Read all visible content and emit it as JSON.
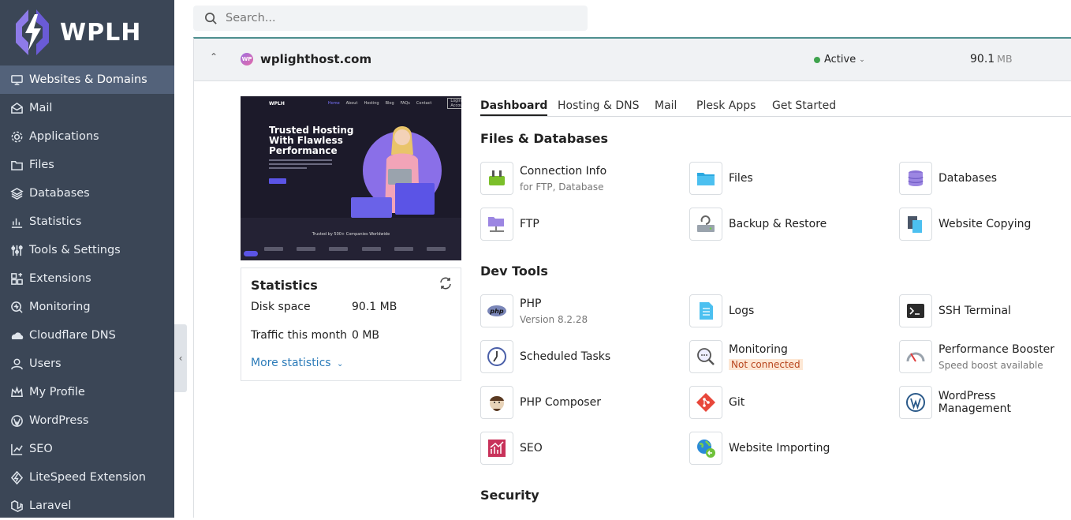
{
  "brand": {
    "name": "WPLH"
  },
  "search": {
    "placeholder": "Search..."
  },
  "sidebar": {
    "items": [
      {
        "label": "Websites & Domains",
        "icon": "monitor-icon"
      },
      {
        "label": "Mail",
        "icon": "mail-icon"
      },
      {
        "label": "Applications",
        "icon": "gear-icon"
      },
      {
        "label": "Files",
        "icon": "folder-icon"
      },
      {
        "label": "Databases",
        "icon": "layers-icon"
      },
      {
        "label": "Statistics",
        "icon": "bar-chart-icon"
      },
      {
        "label": "Tools & Settings",
        "icon": "sliders-icon"
      },
      {
        "label": "Extensions",
        "icon": "extensions-icon"
      },
      {
        "label": "Monitoring",
        "icon": "monitoring-icon"
      },
      {
        "label": "Cloudflare DNS",
        "icon": "cloud-icon"
      },
      {
        "label": "Users",
        "icon": "user-icon"
      },
      {
        "label": "My Profile",
        "icon": "crown-icon"
      },
      {
        "label": "WordPress",
        "icon": "wordpress-icon"
      },
      {
        "label": "SEO",
        "icon": "seo-icon"
      },
      {
        "label": "LiteSpeed Extension",
        "icon": "litespeed-icon"
      },
      {
        "label": "Laravel",
        "icon": "laravel-icon"
      }
    ]
  },
  "domain": {
    "badge": "WP",
    "name": "wplighthost.com",
    "status": "Active",
    "size_value": "90.1",
    "size_unit": "MB"
  },
  "preview": {
    "logo": "WPLH",
    "nav": [
      "Home",
      "About",
      "Hosting",
      "Blog",
      "FAQs",
      "Contact"
    ],
    "cta": "Login Account",
    "headline": "Trusted Hosting With Flawless Performance",
    "trusted": "Trusted by 500+ Companies Worldwide"
  },
  "statistics": {
    "title": "Statistics",
    "disk_label": "Disk space",
    "disk_value": "90.1 MB",
    "traffic_label": "Traffic this month",
    "traffic_value": "0 MB",
    "more": "More statistics"
  },
  "tabs": [
    "Dashboard",
    "Hosting & DNS",
    "Mail",
    "Plesk Apps",
    "Get Started"
  ],
  "sections": {
    "files_db": "Files & Databases",
    "dev_tools": "Dev Tools",
    "security": "Security"
  },
  "tools": {
    "connection_info": {
      "label": "Connection Info",
      "sub": "for FTP, Database"
    },
    "files": {
      "label": "Files"
    },
    "databases": {
      "label": "Databases"
    },
    "ftp": {
      "label": "FTP"
    },
    "backup": {
      "label": "Backup & Restore"
    },
    "website_copying": {
      "label": "Website Copying"
    },
    "php": {
      "label": "PHP",
      "sub": "Version 8.2.28"
    },
    "logs": {
      "label": "Logs"
    },
    "ssh": {
      "label": "SSH Terminal"
    },
    "scheduled": {
      "label": "Scheduled Tasks"
    },
    "monitoring": {
      "label": "Monitoring",
      "warn": "Not connected"
    },
    "perf": {
      "label": "Performance Booster",
      "sub": "Speed boost available"
    },
    "composer": {
      "label": "PHP Composer"
    },
    "git": {
      "label": "Git"
    },
    "wp_mgmt": {
      "label": "WordPress Management"
    },
    "seo": {
      "label": "SEO"
    },
    "importing": {
      "label": "Website Importing"
    }
  }
}
